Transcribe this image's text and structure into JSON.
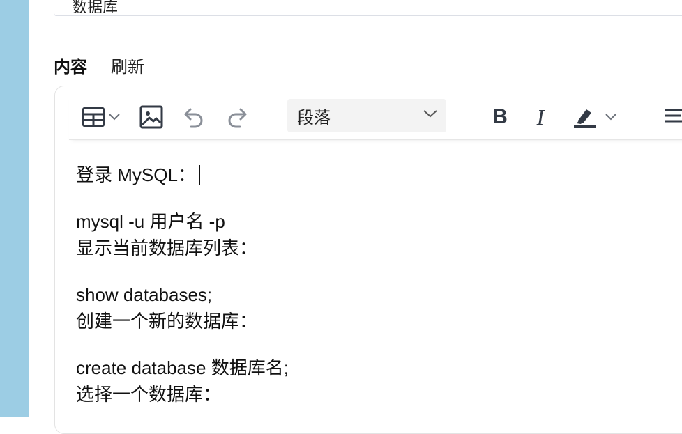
{
  "category_field": {
    "value": "数据库"
  },
  "tabs": [
    {
      "label": "内容",
      "active": true
    },
    {
      "label": "刷新",
      "active": false
    }
  ],
  "toolbar": {
    "icons": [
      "table-icon",
      "image-icon",
      "undo-icon",
      "redo-icon",
      "bold-icon",
      "italic-icon",
      "highlight-icon",
      "align-left-icon"
    ],
    "paragraph_select": {
      "value": "段落"
    },
    "bold_label": "B",
    "italic_label": "I",
    "icon_color": "#333a45",
    "disabled_color": "#8a8f98"
  },
  "content": {
    "lines": [
      "登录 MySQL：",
      "mysql -u 用户名 -p",
      "显示当前数据库列表：",
      "show databases;",
      "创建一个新的数据库：",
      "create database 数据库名;",
      "选择一个数据库："
    ]
  },
  "colors": {
    "left_strip": "#9ccde4",
    "select_bg": "#f3f3f3"
  }
}
